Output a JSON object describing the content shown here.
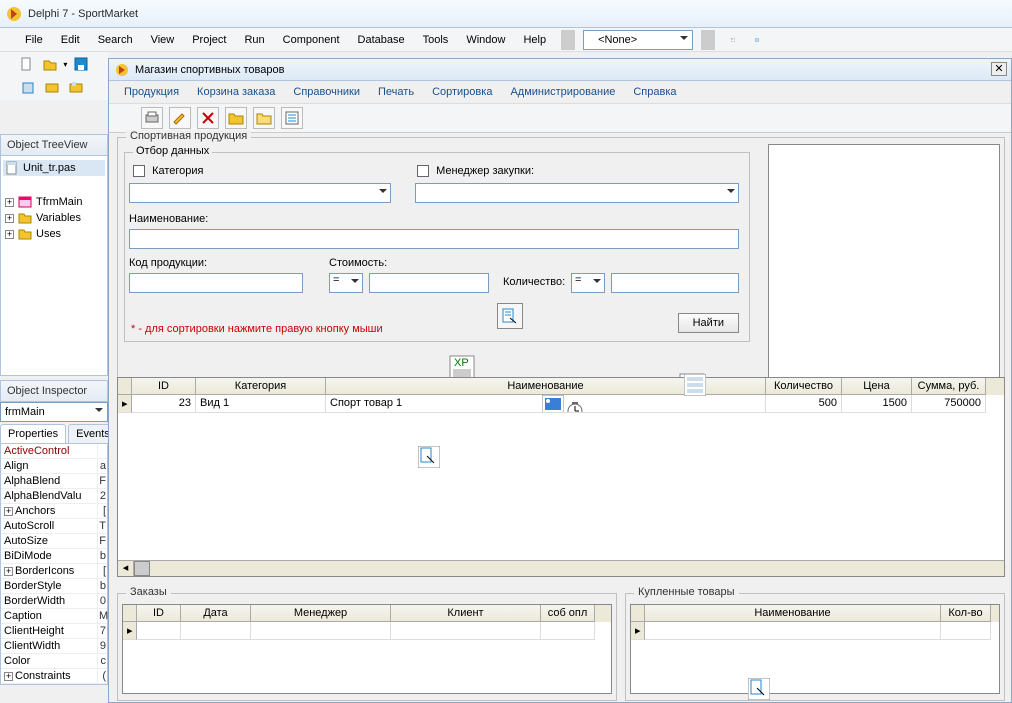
{
  "ide": {
    "title": "Delphi 7 - SportMarket",
    "menus": [
      "File",
      "Edit",
      "Search",
      "View",
      "Project",
      "Run",
      "Component",
      "Database",
      "Tools",
      "Window",
      "Help"
    ],
    "combo_value": "<None>"
  },
  "treeview": {
    "title": "Object TreeView",
    "unit": "Unit_tr.pas",
    "items": [
      "TfrmMain",
      "Variables",
      "Uses"
    ]
  },
  "inspector": {
    "title": "Object Inspector",
    "object": "frmMain",
    "tabs": [
      "Properties",
      "Events"
    ],
    "props": [
      {
        "n": "ActiveControl",
        "v": "",
        "active": true
      },
      {
        "n": "Align",
        "v": "a",
        "exp": false
      },
      {
        "n": "AlphaBlend",
        "v": "F",
        "exp": false
      },
      {
        "n": "AlphaBlendValu",
        "v": "2",
        "exp": false
      },
      {
        "n": "Anchors",
        "v": "[",
        "exp": true
      },
      {
        "n": "AutoScroll",
        "v": "T",
        "exp": false
      },
      {
        "n": "AutoSize",
        "v": "F",
        "exp": false
      },
      {
        "n": "BiDiMode",
        "v": "b",
        "exp": false
      },
      {
        "n": "BorderIcons",
        "v": "[",
        "exp": true
      },
      {
        "n": "BorderStyle",
        "v": "b",
        "exp": false
      },
      {
        "n": "BorderWidth",
        "v": "0",
        "exp": false
      },
      {
        "n": "Caption",
        "v": "M",
        "exp": false
      },
      {
        "n": "ClientHeight",
        "v": "7",
        "exp": false
      },
      {
        "n": "ClientWidth",
        "v": "9",
        "exp": false
      },
      {
        "n": "Color",
        "v": "c",
        "exp": false
      },
      {
        "n": "Constraints",
        "v": "(",
        "exp": true
      }
    ]
  },
  "childform": {
    "title": "Магазин спортивных товаров",
    "menus": [
      "Продукция",
      "Корзина заказа",
      "Справочники",
      "Печать",
      "Сортировка",
      "Администрирование",
      "Справка"
    ],
    "group_sport": "Спортивная продукция",
    "group_filter": "Отбор данных",
    "chk_category": "Категория",
    "chk_manager": "Менеджер закупки:",
    "label_name": "Наименование:",
    "label_code": "Код продукции:",
    "label_cost": "Стоимость:",
    "label_qty": "Количество:",
    "op_eq": "=",
    "btn_find": "Найти",
    "hint": "* - для сортировки нажмите правую кнопку мыши",
    "grid_main": {
      "cols": [
        "ID",
        "Категория",
        "Наименование",
        "Количество",
        "Цена",
        "Сумма, руб."
      ],
      "row": {
        "id": "23",
        "cat": "Вид 1",
        "name": "Спорт товар 1",
        "qty": "500",
        "price": "1500",
        "sum": "750000"
      }
    },
    "group_orders": "Заказы",
    "grid_orders_cols": [
      "ID",
      "Дата",
      "Менеджер",
      "Клиент",
      "соб опл"
    ],
    "group_bought": "Купленные товары",
    "grid_bought_cols": [
      "Наименование",
      "Кол-во"
    ]
  }
}
